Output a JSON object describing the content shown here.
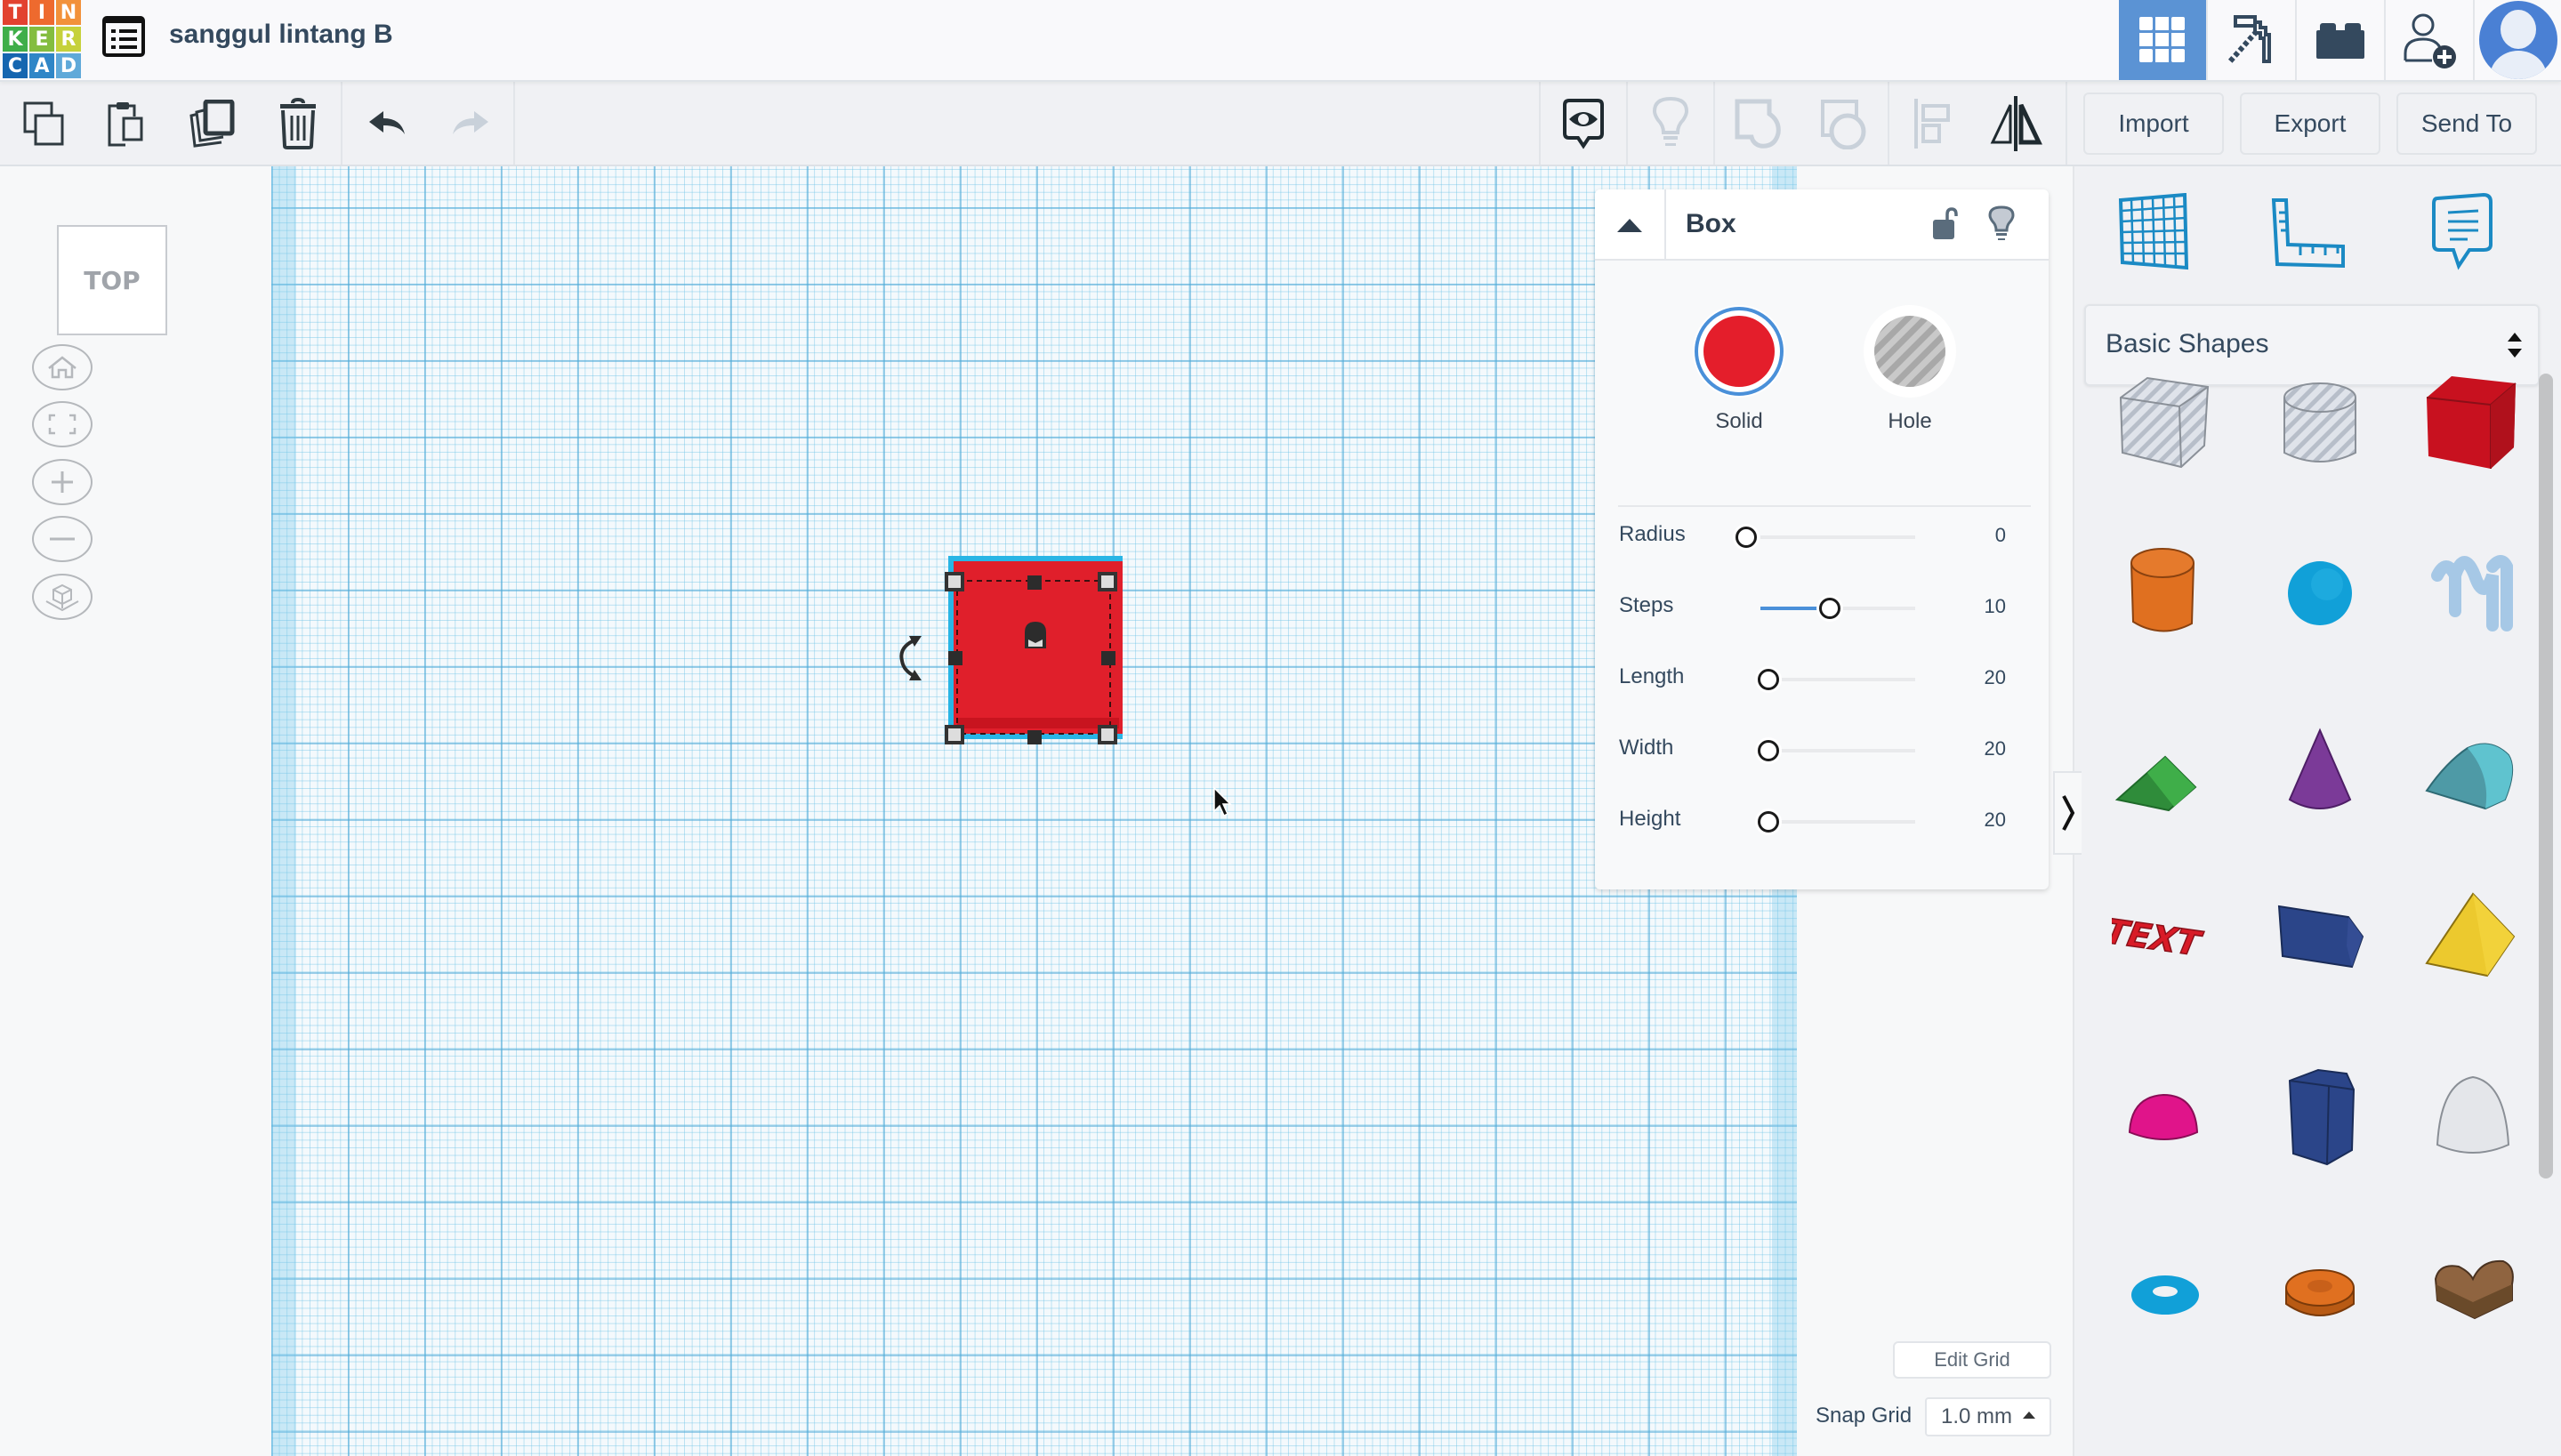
{
  "app": {
    "logo_letters": [
      "T",
      "I",
      "N",
      "K",
      "E",
      "R",
      "C",
      "A",
      "D"
    ],
    "logo_colors": [
      "#e2422f",
      "#ee6a2e",
      "#f2913a",
      "#3fae49",
      "#84bd3f",
      "#c6d13b",
      "#1566b0",
      "#2f86c7",
      "#5fa9d9"
    ],
    "design_title": "sanggul lintang B"
  },
  "topnav": {
    "items": [
      {
        "name": "3d-design-view",
        "icon": "grid-icon",
        "active": true
      },
      {
        "name": "blocks-view",
        "icon": "pickaxe-icon",
        "active": false
      },
      {
        "name": "bricks-view",
        "icon": "brick-icon",
        "active": false
      },
      {
        "name": "invite-user",
        "icon": "add-user-icon",
        "active": false
      },
      {
        "name": "user-profile",
        "icon": "avatar-icon",
        "active": false
      }
    ],
    "active_color": "#5b93d4"
  },
  "toolbar": {
    "left_tools": [
      {
        "name": "copy",
        "icon": "copy-icon",
        "enabled": true
      },
      {
        "name": "paste",
        "icon": "paste-icon",
        "enabled": true
      },
      {
        "name": "duplicate",
        "icon": "duplicate-icon",
        "enabled": true
      },
      {
        "name": "delete",
        "icon": "trash-icon",
        "enabled": true
      },
      {
        "name": "undo",
        "icon": "undo-icon",
        "enabled": true
      },
      {
        "name": "redo",
        "icon": "redo-icon",
        "enabled": false
      }
    ],
    "right_tools": [
      {
        "name": "notes",
        "icon": "eye-note-icon",
        "enabled": true
      },
      {
        "name": "light",
        "icon": "lightbulb-icon",
        "enabled": false
      },
      {
        "name": "group",
        "icon": "group-icon",
        "enabled": false
      },
      {
        "name": "ungroup",
        "icon": "ungroup-icon",
        "enabled": false
      },
      {
        "name": "align",
        "icon": "align-icon",
        "enabled": false
      },
      {
        "name": "mirror",
        "icon": "mirror-icon",
        "enabled": true
      }
    ],
    "import_label": "Import",
    "export_label": "Export",
    "send_to_label": "Send To"
  },
  "view_controls": {
    "viewcube_label": "TOP",
    "buttons": [
      "home-view",
      "fit-all",
      "zoom-in",
      "zoom-out",
      "perspective"
    ]
  },
  "selected_shape": {
    "name": "Box",
    "color": "#e41e2b"
  },
  "inspector": {
    "title": "Box",
    "locked": false,
    "solid_label": "Solid",
    "hole_label": "Hole",
    "solid_color": "#e41e2b",
    "selected_mode": "Solid",
    "properties": [
      {
        "label": "Radius",
        "value": "0",
        "fraction": 0.0
      },
      {
        "label": "Steps",
        "value": "10",
        "fraction": 0.45
      },
      {
        "label": "Length",
        "value": "20",
        "fraction": 0.05
      },
      {
        "label": "Width",
        "value": "20",
        "fraction": 0.05
      },
      {
        "label": "Height",
        "value": "20",
        "fraction": 0.05
      }
    ]
  },
  "right_panel": {
    "tools": [
      {
        "name": "workplane",
        "icon": "workplane-icon"
      },
      {
        "name": "ruler",
        "icon": "ruler-icon"
      },
      {
        "name": "notes",
        "icon": "note-icon"
      }
    ],
    "category_selected": "Basic Shapes",
    "shapes": [
      {
        "name": "Box Hole",
        "color": "#c7ccd4"
      },
      {
        "name": "Cylinder Hole",
        "color": "#c7ccd4"
      },
      {
        "name": "Box",
        "color": "#c8111f"
      },
      {
        "name": "Cylinder",
        "color": "#e07020"
      },
      {
        "name": "Sphere",
        "color": "#11a0d8"
      },
      {
        "name": "Scribble",
        "color": "#a6c8e6"
      },
      {
        "name": "Roof",
        "color": "#3fae49"
      },
      {
        "name": "Cone",
        "color": "#7b3a98"
      },
      {
        "name": "Round Roof",
        "color": "#5fc3cf"
      },
      {
        "name": "Text",
        "color": "#d81b27"
      },
      {
        "name": "Polygon",
        "color": "#2b4589"
      },
      {
        "name": "Pyramid",
        "color": "#ecc92e"
      },
      {
        "name": "Half Sphere",
        "color": "#e0148a"
      },
      {
        "name": "Hexagonal Prism",
        "color": "#2b4589"
      },
      {
        "name": "Paraboloid",
        "color": "#e4e6ea"
      },
      {
        "name": "Torus",
        "color": "#11a0d8"
      },
      {
        "name": "Tube",
        "color": "#e07020"
      },
      {
        "name": "Heart",
        "color": "#8f6440"
      }
    ]
  },
  "grid_controls": {
    "edit_grid_label": "Edit Grid",
    "snap_grid_label": "Snap Grid",
    "snap_grid_value": "1.0 mm"
  }
}
